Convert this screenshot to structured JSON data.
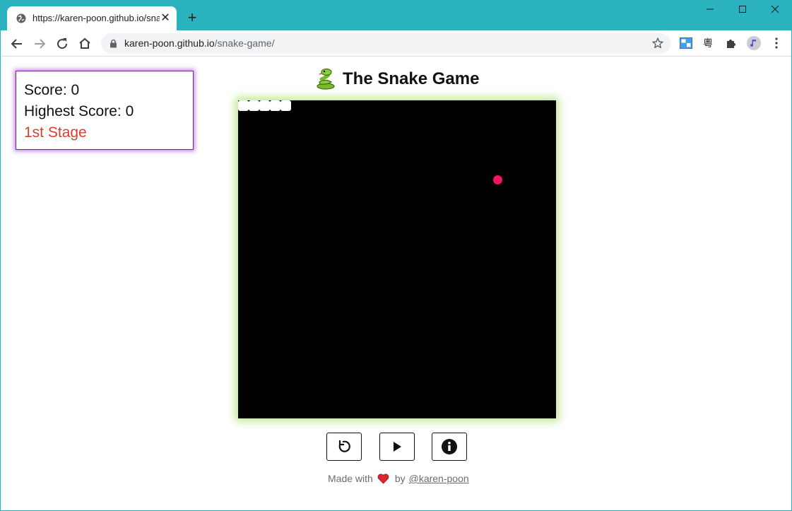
{
  "browser": {
    "tab_title": "https://karen-poon.github.io/snake-game/",
    "url_host": "karen-poon.github.io",
    "url_path": "/snake-game/",
    "accent": "#2ab3bf"
  },
  "scoreboard": {
    "score_label": "Score: 0",
    "highest_label": "Highest Score: 0",
    "stage_label": "1st Stage",
    "stage_color": "#e33a2c"
  },
  "game": {
    "title": "The Snake Game",
    "title_icon": "snake-icon",
    "snake_segments": 5,
    "food_color": "#f0185b"
  },
  "controls": [
    {
      "name": "restart-button",
      "icon": "restart-icon"
    },
    {
      "name": "play-button",
      "icon": "play-icon"
    },
    {
      "name": "info-button",
      "icon": "info-icon"
    }
  ],
  "footer": {
    "made_with": "Made with",
    "by": "by",
    "author": "@karen-poon"
  }
}
